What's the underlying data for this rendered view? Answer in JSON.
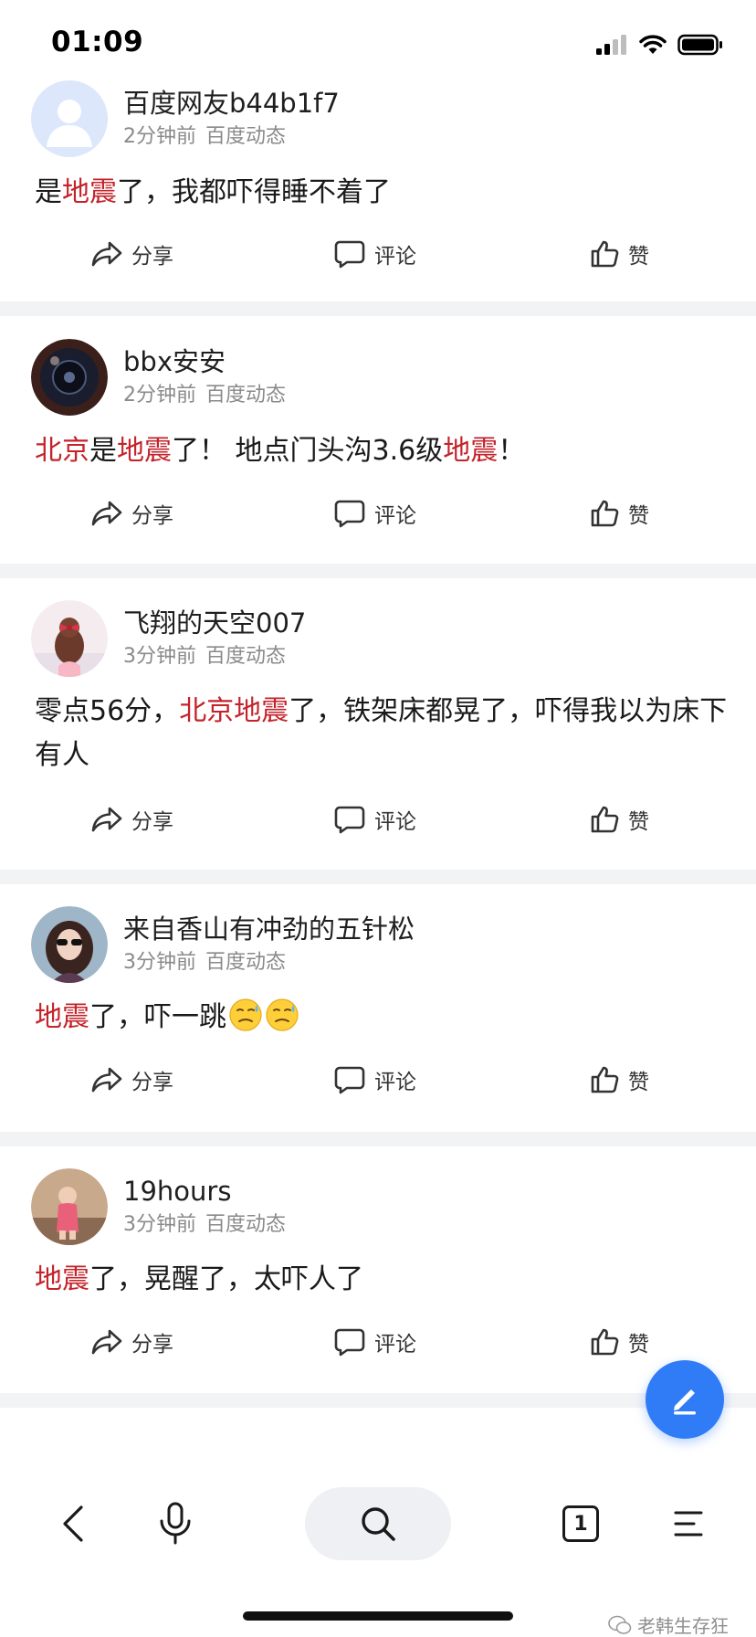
{
  "status_bar": {
    "time": "01:09"
  },
  "posts": [
    {
      "username": "百度网友b44b1f7",
      "time": "2分钟前",
      "source": "百度动态",
      "content_parts": [
        {
          "text": "是",
          "hl": false
        },
        {
          "text": "地震",
          "hl": true
        },
        {
          "text": "了，我都吓得睡不着了",
          "hl": false
        }
      ]
    },
    {
      "username": "bbx安安",
      "time": "2分钟前",
      "source": "百度动态",
      "content_parts": [
        {
          "text": "北京",
          "hl": true
        },
        {
          "text": "是",
          "hl": false
        },
        {
          "text": "地震",
          "hl": true
        },
        {
          "text": "了！ 地点门头沟3.6级",
          "hl": false
        },
        {
          "text": "地震",
          "hl": true
        },
        {
          "text": "！",
          "hl": false
        }
      ]
    },
    {
      "username": "飞翔的天空007",
      "time": "3分钟前",
      "source": "百度动态",
      "content_parts": [
        {
          "text": "零点56分，",
          "hl": false
        },
        {
          "text": "北京地震",
          "hl": true
        },
        {
          "text": "了，铁架床都晃了，吓得我以为床下有人",
          "hl": false
        }
      ]
    },
    {
      "username": "来自香山有冲劲的五针松",
      "time": "3分钟前",
      "source": "百度动态",
      "content_parts": [
        {
          "text": "地震",
          "hl": true
        },
        {
          "text": "了，吓一跳",
          "hl": false
        }
      ]
    },
    {
      "username": "19hours",
      "time": "3分钟前",
      "source": "百度动态",
      "content_parts": [
        {
          "text": "地震",
          "hl": true
        },
        {
          "text": "了，晃醒了，太吓人了",
          "hl": false
        }
      ]
    }
  ],
  "actions": {
    "share": "分享",
    "comment": "评论",
    "like": "赞"
  },
  "bottom_nav": {
    "tab_count": "1"
  },
  "watermark": "老韩生存狂",
  "colors": {
    "highlight": "#c4232b",
    "fab": "#2f7cf6",
    "divider": "#f2f3f5"
  },
  "icons": [
    "signal-icon",
    "wifi-icon",
    "battery-icon",
    "share-icon",
    "comment-icon",
    "thumbs-up-icon",
    "pen-icon",
    "back-icon",
    "microphone-icon",
    "search-icon",
    "menu-icon",
    "wechat-icon"
  ]
}
